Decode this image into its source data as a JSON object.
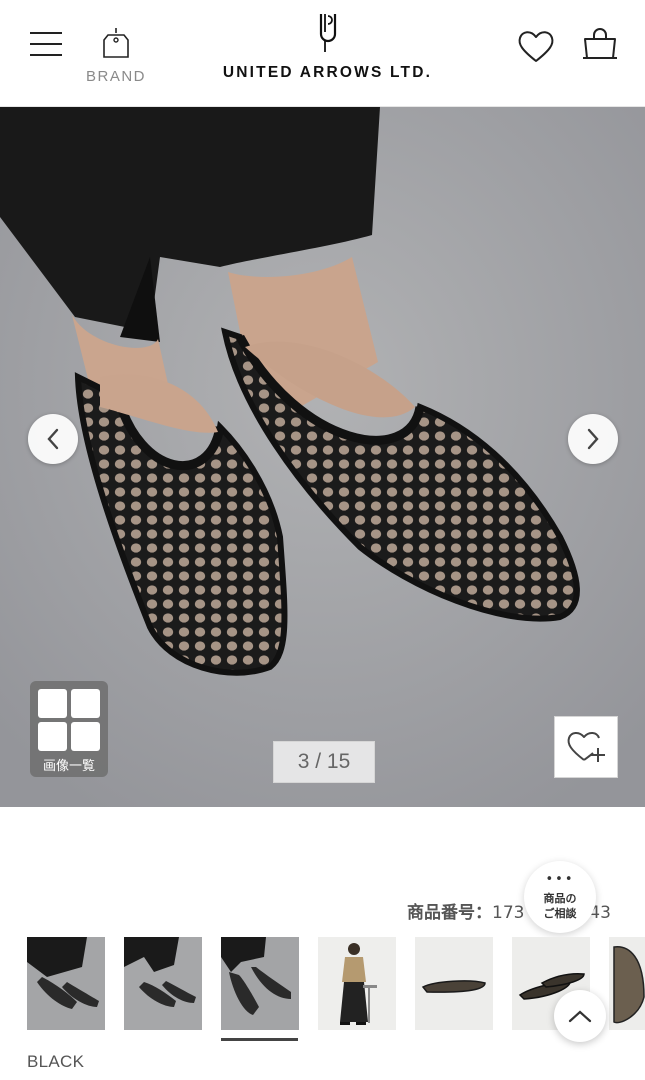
{
  "header": {
    "brand_label": "BRAND",
    "logo_text": "UNITED ARROWS LTD."
  },
  "gallery": {
    "counter": "3 / 15",
    "grid_button_label": "画像一覧"
  },
  "product": {
    "code_label": "商品番号：",
    "code_value_visible_start": "173",
    "code_value_visible_end": "643",
    "color": "BLACK"
  },
  "consult_button": {
    "dots": "•••",
    "line1": "商品の",
    "line2": "ご相談"
  },
  "thumbnails": {
    "count_visible": 7,
    "active_index": 2
  },
  "colors": {
    "header_border": "#e6e6e6",
    "hero_background": "#a3a4a6",
    "active_indicator": "#444444"
  }
}
